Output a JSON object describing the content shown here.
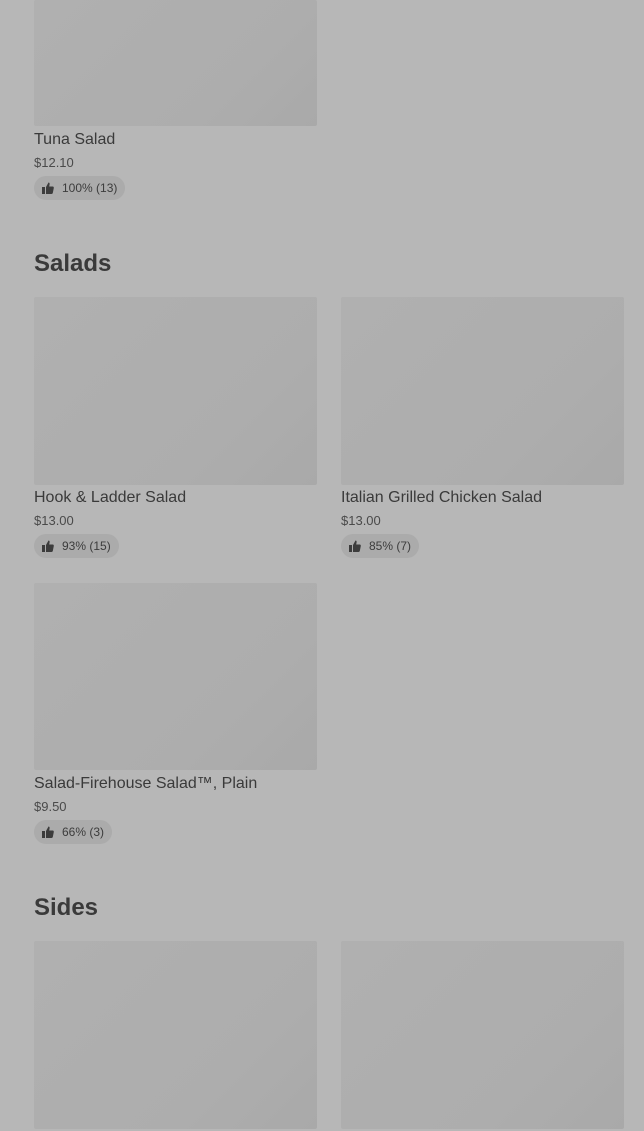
{
  "sections": {
    "previous": {
      "items": [
        {
          "name": "Tuna Salad",
          "price": "$12.10",
          "rating": "100% (13)"
        }
      ]
    },
    "salads": {
      "title": "Salads",
      "items": [
        {
          "name": "Hook & Ladder Salad",
          "price": "$13.00",
          "rating": "93% (15)"
        },
        {
          "name": "Italian Grilled Chicken Salad",
          "price": "$13.00",
          "rating": "85% (7)"
        },
        {
          "name": "Salad-Firehouse Salad™, Plain",
          "price": "$9.50",
          "rating": "66% (3)"
        }
      ]
    },
    "sides": {
      "title": "Sides"
    }
  },
  "icons": {
    "rating": "thumbs-up-icon"
  },
  "colors": {
    "background": "#b7b7b7",
    "placeholder_image": "#afafaf",
    "pill": "#ababab",
    "text": "#3a3a3a"
  }
}
